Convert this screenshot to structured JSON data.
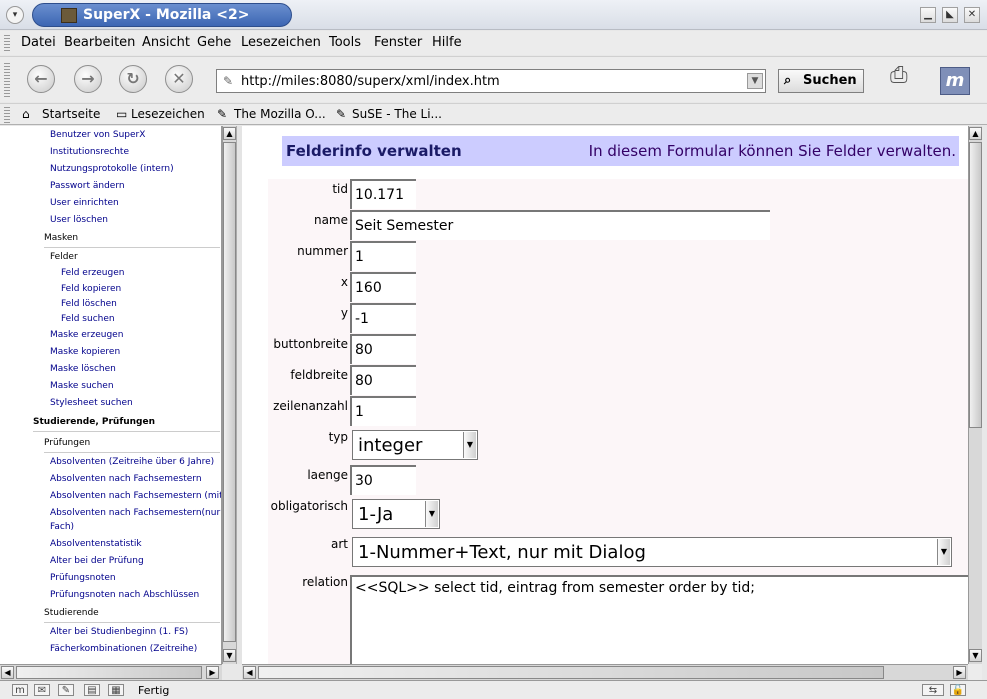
{
  "window": {
    "title": "SuperX - Mozilla <2>",
    "buttons": [
      "minimize-icon",
      "maximize-icon",
      "close-icon"
    ]
  },
  "menu": {
    "items": [
      "Datei",
      "Bearbeiten",
      "Ansicht",
      "Gehe",
      "Lesezeichen",
      "Tools",
      "Fenster",
      "Hilfe"
    ]
  },
  "nav": {
    "url": "http://miles:8080/superx/xml/index.htm",
    "search_label": "Suchen"
  },
  "bookmarks": {
    "items": [
      "Startseite",
      "Lesezeichen",
      "The Mozilla O...",
      "SuSE - The Li..."
    ]
  },
  "sidebar": {
    "items": [
      {
        "label": "Benutzer von SuperX",
        "type": "link"
      },
      {
        "label": "Institutionsrechte",
        "type": "link"
      },
      {
        "label": "Nutzungsprotokolle (intern)",
        "type": "link"
      },
      {
        "label": "Passwort ändern",
        "type": "link"
      },
      {
        "label": "User einrichten",
        "type": "link"
      },
      {
        "label": "User löschen",
        "type": "link"
      },
      {
        "label": "Masken",
        "type": "header"
      },
      {
        "label": "Felder",
        "type": "header"
      },
      {
        "label": "Feld erzeugen",
        "type": "link"
      },
      {
        "label": "Feld kopieren",
        "type": "link"
      },
      {
        "label": "Feld löschen",
        "type": "link"
      },
      {
        "label": "Feld suchen",
        "type": "link"
      },
      {
        "label": "Maske erzeugen",
        "type": "link"
      },
      {
        "label": "Maske kopieren",
        "type": "link"
      },
      {
        "label": "Maske löschen",
        "type": "link"
      },
      {
        "label": "Maske suchen",
        "type": "link"
      },
      {
        "label": "Stylesheet suchen",
        "type": "link"
      },
      {
        "label": "Studierende, Prüfungen",
        "type": "bold"
      },
      {
        "label": "Prüfungen",
        "type": "header"
      },
      {
        "label": "Absolventen (Zeitreihe über 6 Jahre)",
        "type": "link"
      },
      {
        "label": "Absolventen nach Fachsemestern",
        "type": "link"
      },
      {
        "label": "Absolventen nach Fachsemestern (mit",
        "type": "link"
      },
      {
        "label": "Absolventen nach Fachsemestern(nur",
        "type": "link"
      },
      {
        "label": "Fach)",
        "type": "link"
      },
      {
        "label": "Absolventenstatistik",
        "type": "link"
      },
      {
        "label": "Alter bei der Prüfung",
        "type": "link"
      },
      {
        "label": "Prüfungsnoten",
        "type": "link"
      },
      {
        "label": "Prüfungsnoten nach Abschlüssen",
        "type": "link"
      },
      {
        "label": "Studierende",
        "type": "header"
      },
      {
        "label": "Alter bei Studienbeginn (1. FS)",
        "type": "link"
      },
      {
        "label": "Fächerkombinationen (Zeitreihe)",
        "type": "link"
      }
    ]
  },
  "form": {
    "title": "Felderinfo verwalten",
    "subtitle": "In diesem Formular können Sie Felder verwalten.",
    "fields": {
      "tid": {
        "label": "tid",
        "value": "10.171"
      },
      "name": {
        "label": "name",
        "value": "Seit Semester"
      },
      "nummer": {
        "label": "nummer",
        "value": "1"
      },
      "x": {
        "label": "x",
        "value": "160"
      },
      "y": {
        "label": "y",
        "value": "-1"
      },
      "buttonbreite": {
        "label": "buttonbreite",
        "value": "80"
      },
      "feldbreite": {
        "label": "feldbreite",
        "value": "80"
      },
      "zeilenanzahl": {
        "label": "zeilenanzahl",
        "value": "1"
      },
      "typ": {
        "label": "typ",
        "value": "integer"
      },
      "laenge": {
        "label": "laenge",
        "value": "30"
      },
      "obligatorisch": {
        "label": "obligatorisch",
        "value": "1-Ja"
      },
      "art": {
        "label": "art",
        "value": "1-Nummer+Text, nur mit Dialog"
      },
      "relation": {
        "label": "relation",
        "value": "<<SQL>> select tid, eintrag from semester order by tid;"
      }
    }
  },
  "status": {
    "text": "Fertig"
  }
}
